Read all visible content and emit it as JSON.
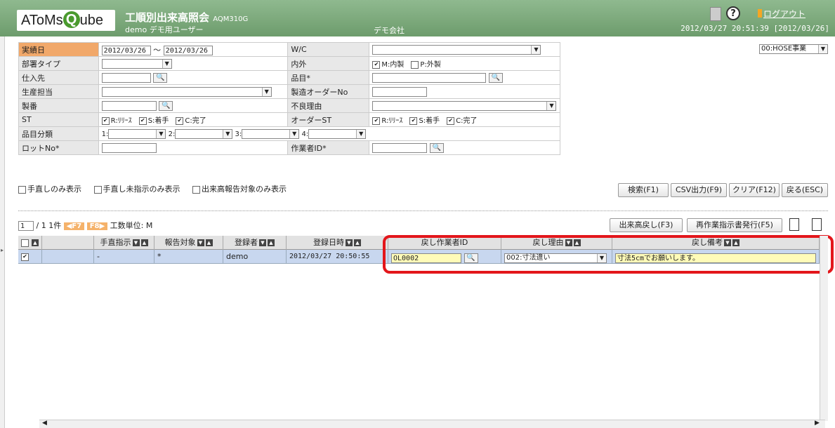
{
  "header": {
    "logo_text": "AToMs",
    "logo_q": "Q",
    "logo_rest": "ube",
    "title": "工順別出来高照会",
    "code": "AQM310G",
    "user": "demo デモ用ユーザー",
    "company": "デモ会社",
    "datetime": "2012/03/27 20:51:39 [2012/03/26]",
    "logout": "ログアウト",
    "help": "?"
  },
  "form": {
    "jisseki_label": "実績日",
    "date_from": "2012/03/26",
    "date_sep": "～",
    "date_to": "2012/03/26",
    "wc_label": "W/C",
    "busho_label": "部署タイプ",
    "naigai_label": "内外",
    "naigai_m": "M:内製",
    "naigai_p": "P:外製",
    "shiire_label": "仕入先",
    "hinmoku_label": "品目*",
    "seisan_label": "生産担当",
    "seizo_label": "製造オーダーNo",
    "seiban_label": "製番",
    "furyo_label": "不良理由",
    "st_label": "ST",
    "st_r": "R:ﾘﾘｰｽ",
    "st_s": "S:着手",
    "st_c": "C:完了",
    "order_st_label": "オーダーST",
    "bunrui_label": "品目分類",
    "b1": "1:",
    "b2": "2:",
    "b3": "3:",
    "b4": "4:",
    "lot_label": "ロットNo*",
    "worker_label": "作業者ID*",
    "org_select": "00:HOSE事業"
  },
  "filters": {
    "f1": "手直しのみ表示",
    "f2": "手直し未指示のみ表示",
    "f3": "出来高報告対象のみ表示"
  },
  "buttons": {
    "search": "検索(F1)",
    "csv": "CSV出力(F9)",
    "clear": "クリア(F12)",
    "back": "戻る(ESC)",
    "return_output": "出来高戻し(F3)",
    "reissue": "再作業指示書発行(F5)"
  },
  "pager": {
    "page": "1",
    "info": "/ 1 1件",
    "prev": "◀F7",
    "next": "F8▶",
    "unit": "工数単位: M"
  },
  "grid": {
    "headers": [
      "手直指示",
      "報告対象",
      "登録者",
      "登録日時",
      "戻し作業者ID",
      "戻し理由",
      "戻し備考"
    ],
    "row": {
      "checked": "✔",
      "tenaoshi": "-",
      "houkoku": "*",
      "user": "demo",
      "datetime": "2012/03/27 20:50:55",
      "worker_id": "OL0002",
      "reason": "002:寸法違い",
      "remark": "寸法5cmでお願いします。"
    }
  },
  "colors": {
    "header_green": "#6d9c6c",
    "required_label": "#f1a86a",
    "row_selected": "#c8d7ef",
    "highlight": "#e3161b"
  }
}
